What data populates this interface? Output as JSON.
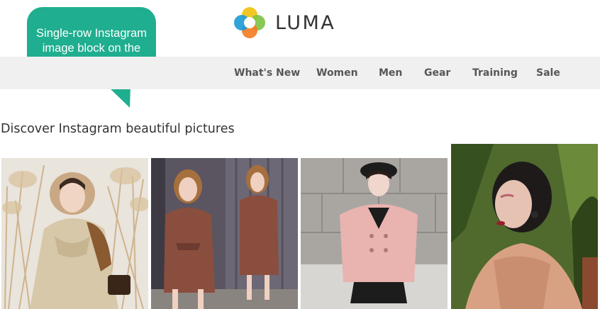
{
  "brand": {
    "name": "LUMA"
  },
  "callout": {
    "text": "Single-row Instagram image block on the home page"
  },
  "nav": {
    "items": [
      {
        "label": "What's New"
      },
      {
        "label": "Women"
      },
      {
        "label": "Men"
      },
      {
        "label": "Gear"
      },
      {
        "label": "Training"
      },
      {
        "label": "Sale"
      }
    ]
  },
  "section": {
    "heading": "Discover Instagram beautiful pictures"
  },
  "colors": {
    "callout": "#1fae8f",
    "navbar": "#f0f0f0",
    "text": "#333333"
  }
}
